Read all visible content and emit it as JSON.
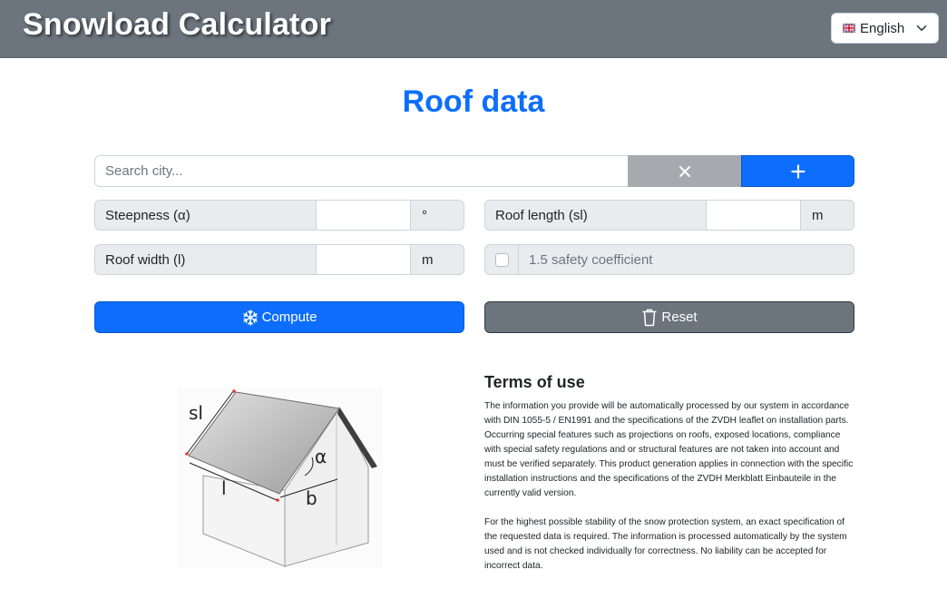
{
  "header": {
    "title": "Snowload Calculator",
    "language": {
      "selected": "English",
      "flag_icon": "uk-flag-icon"
    }
  },
  "page_title": "Roof data",
  "search": {
    "placeholder": "Search city...",
    "value": "",
    "clear_icon": "close-icon",
    "add_icon": "plus-icon"
  },
  "fields": {
    "steepness": {
      "label": "Steepness (α)",
      "value": "",
      "unit": "°"
    },
    "roof_length": {
      "label": "Roof length (sl)",
      "value": "",
      "unit": "m"
    },
    "roof_width": {
      "label": "Roof width (l)",
      "value": "",
      "unit": "m"
    }
  },
  "safety": {
    "label": "1.5 safety coefficient",
    "checked": false
  },
  "actions": {
    "compute_label": "Compute",
    "compute_icon": "snowflake-icon",
    "reset_label": "Reset",
    "reset_icon": "trash-icon"
  },
  "diagram": {
    "labels": {
      "sl": "sl",
      "l": "l",
      "b": "b",
      "alpha": "α"
    }
  },
  "terms": {
    "title": "Terms of use",
    "paragraph1": "The information you provide will be automatically processed by our system in accordance with DIN 1055-5 / EN1991 and the specifications of the ZVDH leaflet on installation parts. Occurring special features such as projections on roofs, exposed locations, compliance with special safety regulations and or structural features are not taken into account and must be verified separately. This product generation applies in connection with the specific installation instructions and the specifications of the ZVDH Merkblatt Einbauteile in the currently valid version.",
    "paragraph2": "For the highest possible stability of the snow protection system, an exact specification of the requested data is required. The information is processed automatically by the system used and is not checked individually for correctness. No liability can be accepted for incorrect data."
  },
  "colors": {
    "header_bg": "#6c757d",
    "primary": "#0d6efd",
    "secondary": "#6c757d",
    "clear_button": "#a6aaae"
  }
}
